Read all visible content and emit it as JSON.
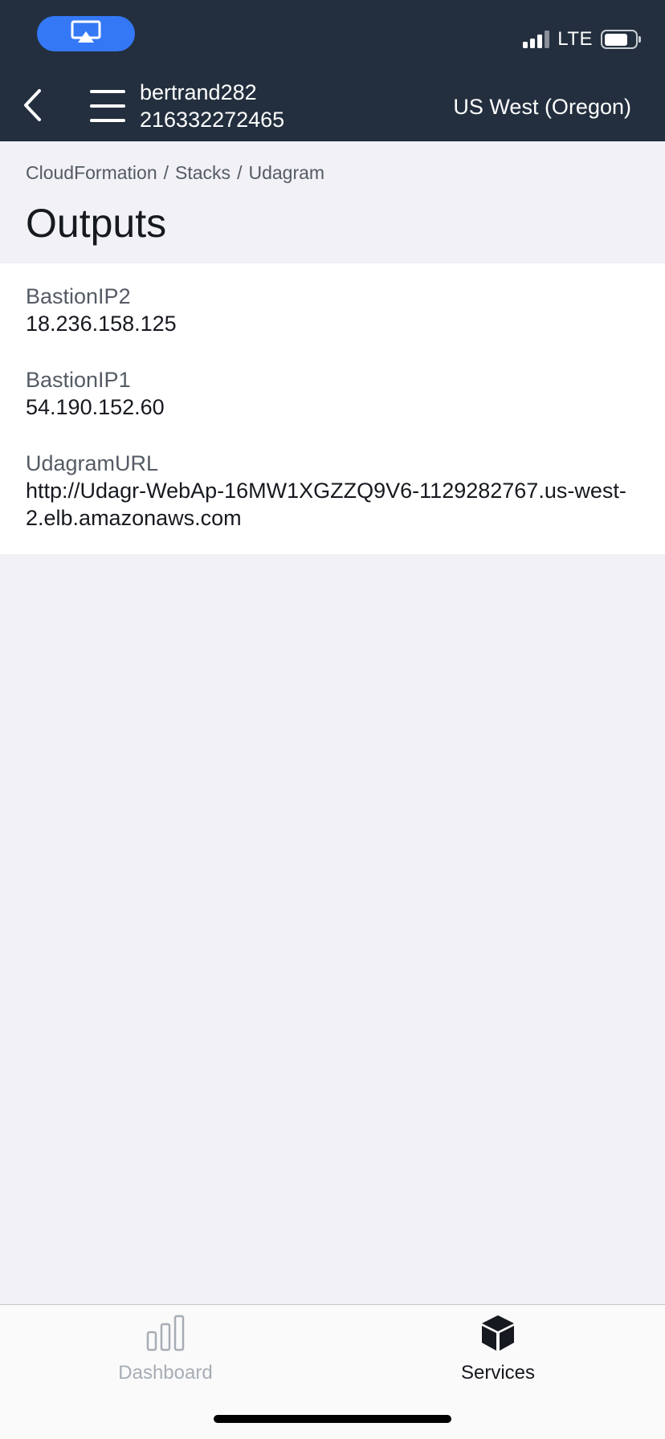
{
  "status_bar": {
    "network": "LTE",
    "airplay_icon": "airplay-icon",
    "signal_icon": "cellular-signal-icon",
    "battery_icon": "battery-icon",
    "pill_color": "#3478f6"
  },
  "header": {
    "back_icon": "chevron-left-icon",
    "menu_icon": "hamburger-menu-icon",
    "account_name": "bertrand282",
    "account_id": "216332272465",
    "region": "US West (Oregon)",
    "background": "#232f3e"
  },
  "breadcrumb": {
    "items": [
      "CloudFormation",
      "Stacks",
      "Udagram"
    ],
    "separator": "/"
  },
  "page": {
    "title": "Outputs"
  },
  "outputs": [
    {
      "key": "BastionIP2",
      "value": "18.236.158.125"
    },
    {
      "key": "BastionIP1",
      "value": "54.190.152.60"
    },
    {
      "key": "UdagramURL",
      "value": "http://Udagr-WebAp-16MW1XGZZQ9V6-1129282767.us-west-2.elb.amazonaws.com"
    }
  ],
  "tab_bar": {
    "tabs": [
      {
        "label": "Dashboard",
        "icon": "bar-chart-icon",
        "active": false
      },
      {
        "label": "Services",
        "icon": "cube-icon",
        "active": true
      }
    ]
  }
}
